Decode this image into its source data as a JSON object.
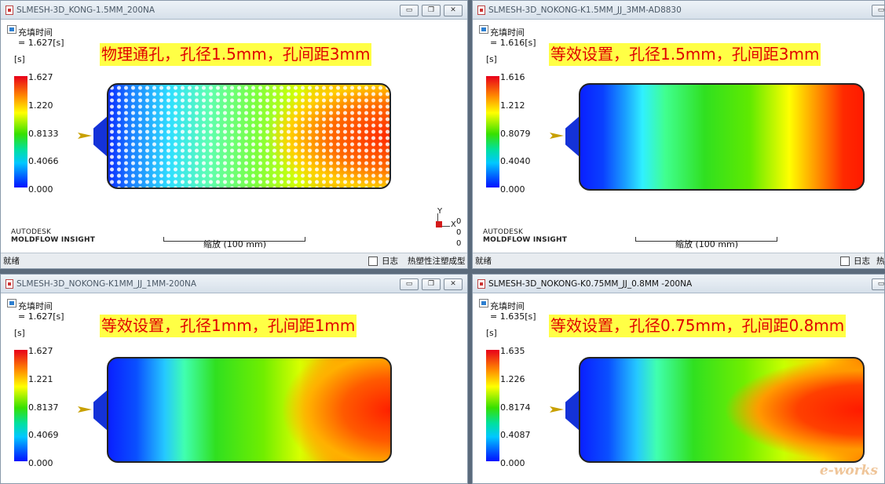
{
  "windows": [
    {
      "title": "SLMESH-3D_KONG-1.5MM_200NA",
      "legend_title": "充填时间",
      "legend_value": "= 1.627[s]",
      "unit": "[s]",
      "ticks": [
        "1.627",
        "1.220",
        "0.8133",
        "0.4066",
        "0.000"
      ],
      "heading": "物理通孔，孔径1.5mm，孔间距3mm",
      "brand_line1": "AUTODESK",
      "brand_line2": "MOLDFLOW INSIGHT",
      "scale_label": "缩放 (100 mm)",
      "axis_labels": [
        "Y",
        "X",
        "0",
        "0",
        "0"
      ],
      "status_left": "就绪",
      "status_log": "日志",
      "status_mode": "热塑性注塑成型"
    },
    {
      "title": "SLMESH-3D_NOKONG-K1.5MM_JJ_3MM-AD8830",
      "legend_title": "充填时间",
      "legend_value": "= 1.616[s]",
      "unit": "[s]",
      "ticks": [
        "1.616",
        "1.212",
        "0.8079",
        "0.4040",
        "0.000"
      ],
      "heading": "等效设置，孔径1.5mm，孔间距3mm",
      "brand_line1": "AUTODESK",
      "brand_line2": "MOLDFLOW INSIGHT",
      "scale_label": "缩放 (100 mm)",
      "status_left": "就绪",
      "status_log": "日志",
      "status_mode": "热"
    },
    {
      "title": "SLMESH-3D_NOKONG-K1MM_JJ_1MM-200NA",
      "legend_title": "充填时间",
      "legend_value": "= 1.627[s]",
      "unit": "[s]",
      "ticks": [
        "1.627",
        "1.221",
        "0.8137",
        "0.4069",
        "0.000"
      ],
      "heading": "等效设置，孔径1mm，孔间距1mm"
    },
    {
      "title": "SLMESH-3D_NOKONG-K0.75MM_JJ_0.8MM -200NA",
      "legend_title": "充填时间",
      "legend_value": "= 1.635[s]",
      "unit": "[s]",
      "ticks": [
        "1.635",
        "1.226",
        "0.8174",
        "0.4087",
        "0.000"
      ],
      "heading": "等效设置，孔径0.75mm，孔间距0.8mm"
    }
  ],
  "window_buttons": {
    "minimize": "▭",
    "restore": "❐",
    "close": "✕"
  },
  "watermark": "e-works",
  "colors": {
    "heading_bg": "#ffff45",
    "heading_text": "#e00000",
    "desktop": "#5b6b7c"
  }
}
